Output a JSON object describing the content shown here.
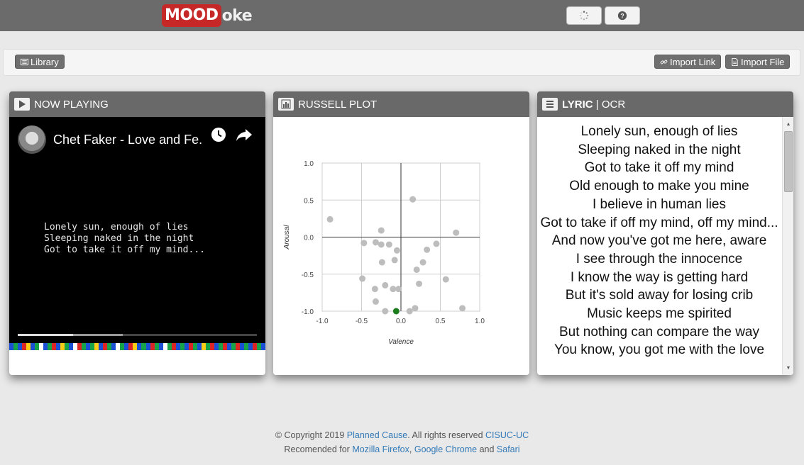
{
  "header": {
    "logo_main": "MOOD",
    "logo_tail": "oke",
    "colors": {
      "bar": "#6b6b6b",
      "logo": "#c62828"
    }
  },
  "toolbar": {
    "library_label": "Library",
    "import_link_label": "Import Link",
    "import_file_label": "Import File"
  },
  "now_playing": {
    "title": "NOW PLAYING",
    "video_title": "Chet Faker - Love and Fe...",
    "video_lyrics": "Lonely sun, enough of lies\nSleeping naked in the night\nGot to take it off my mind...",
    "played_fraction": 0.23,
    "buffered_fraction": 0.44,
    "mood_colors": [
      "#1a4fd6",
      "#16a34a",
      "#1a4fd6",
      "#dc2626",
      "#facc15",
      "#1a4fd6",
      "#16a34a",
      "#ffffff",
      "#1a4fd6",
      "#16a34a",
      "#dc2626",
      "#1a4fd6",
      "#facc15",
      "#16a34a",
      "#1a4fd6",
      "#ffffff",
      "#dc2626",
      "#16a34a",
      "#1a4fd6",
      "#16a34a",
      "#facc15",
      "#1a4fd6",
      "#dc2626",
      "#16a34a",
      "#1a4fd6",
      "#ffffff",
      "#16a34a",
      "#1a4fd6",
      "#dc2626",
      "#facc15",
      "#1a4fd6",
      "#16a34a",
      "#1a4fd6",
      "#dc2626",
      "#16a34a",
      "#1a4fd6",
      "#ffffff",
      "#16a34a",
      "#dc2626",
      "#1a4fd6",
      "#16a34a",
      "#1a4fd6",
      "#dc2626",
      "#16a34a",
      "#1a4fd6",
      "#facc15",
      "#16a34a",
      "#dc2626",
      "#1a4fd6",
      "#16a34a",
      "#dc2626",
      "#1a4fd6",
      "#16a34a",
      "#dc2626",
      "#1a4fd6",
      "#16a34a",
      "#1a4fd6",
      "#dc2626",
      "#16a34a",
      "#1a4fd6"
    ]
  },
  "russell": {
    "title": "RUSSELL PLOT"
  },
  "chart_data": {
    "type": "scatter",
    "title": "",
    "xlabel": "Valence",
    "ylabel": "Arousal",
    "xlim": [
      -1.0,
      1.0
    ],
    "ylim": [
      -1.0,
      1.0
    ],
    "xticks": [
      "-1.0",
      "-0.5",
      "0.0",
      "0.5",
      "1.0"
    ],
    "yticks": [
      "1.0",
      "0.5",
      "0.0",
      "-0.5",
      "-1.0"
    ],
    "grid": true,
    "point_color": "#bdbdbd",
    "current_color": "#1b7d1b",
    "points": [
      {
        "x": -0.9,
        "y": 0.24
      },
      {
        "x": 0.15,
        "y": 0.51
      },
      {
        "x": 0.7,
        "y": 0.06
      },
      {
        "x": -0.25,
        "y": 0.09
      },
      {
        "x": -0.47,
        "y": -0.08
      },
      {
        "x": -0.32,
        "y": -0.07
      },
      {
        "x": -0.25,
        "y": -0.1
      },
      {
        "x": -0.15,
        "y": -0.1
      },
      {
        "x": -0.05,
        "y": -0.18
      },
      {
        "x": 0.45,
        "y": -0.09
      },
      {
        "x": 0.33,
        "y": -0.17
      },
      {
        "x": -0.08,
        "y": -0.31
      },
      {
        "x": -0.24,
        "y": -0.34
      },
      {
        "x": 0.28,
        "y": -0.34
      },
      {
        "x": 0.2,
        "y": -0.44
      },
      {
        "x": -0.49,
        "y": -0.56
      },
      {
        "x": 0.57,
        "y": -0.57
      },
      {
        "x": -0.2,
        "y": -0.65
      },
      {
        "x": 0.23,
        "y": -0.63
      },
      {
        "x": -0.33,
        "y": -0.7
      },
      {
        "x": -0.1,
        "y": -0.7
      },
      {
        "x": -0.03,
        "y": -0.7
      },
      {
        "x": -0.32,
        "y": -0.87
      },
      {
        "x": -0.2,
        "y": -1.0
      },
      {
        "x": 0.18,
        "y": -0.96
      },
      {
        "x": 0.11,
        "y": -1.0
      },
      {
        "x": 0.78,
        "y": -0.96
      }
    ],
    "current": {
      "x": -0.06,
      "y": -1.0
    }
  },
  "lyric": {
    "title_main": "LYRIC",
    "title_sep": " | ",
    "title_alt": "OCR",
    "lines": [
      "Lonely sun, enough of lies",
      "Sleeping naked in the night",
      "Got to take it off my mind",
      "Old enough to make you mine",
      "I believe in human lies",
      "Got to take if off my mind, off my mind...",
      "And now you've got me here, aware",
      "I see through the innocence",
      "I know the way is getting hard",
      "But it's sold away for losing crib",
      "Music keeps me spirited",
      "But nothing can compare the way",
      "You know, you got me with the love"
    ]
  },
  "footer": {
    "copyright_prefix": "© Copyright 2019 ",
    "planned_cause": "Planned Cause",
    "rights": ". All rights reserved ",
    "cisuc": "CISUC-UC",
    "recommended_prefix": "Recomended for ",
    "firefox": "Mozilla Firefox",
    "comma": ", ",
    "chrome": "Google Chrome",
    "and": " and ",
    "safari": "Safari"
  }
}
